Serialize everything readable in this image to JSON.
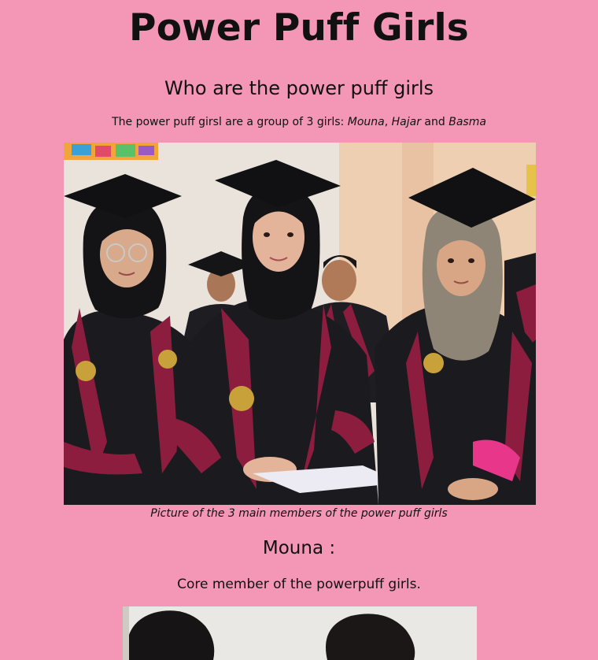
{
  "title": "Power Puff Girls",
  "section_heading": "Who are the power puff girls",
  "intro": {
    "text": "The power puff girsl are a group of 3 girls: ",
    "name1": "Mouna",
    "sep1": ", ",
    "name2": "Hajar",
    "sep2": " and ",
    "name3": "Basma"
  },
  "group_photo": {
    "caption": "Picture of the 3 main members of the power puff girls"
  },
  "member": {
    "name_heading": "Mouna :",
    "description": "Core member of the powerpuff girls."
  },
  "colors": {
    "background": "#f497b6",
    "text": "#111111",
    "gown": "#1b1b1f",
    "stole": "#8c1d3f"
  }
}
